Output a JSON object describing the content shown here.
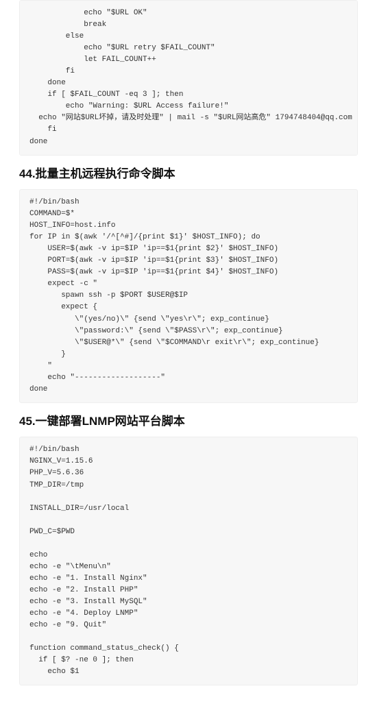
{
  "block1": {
    "code": "            echo \"$URL OK\"\n            break\n        else\n            echo \"$URL retry $FAIL_COUNT\"\n            let FAIL_COUNT++\n        fi\n    done\n    if [ $FAIL_COUNT -eq 3 ]; then\n        echo \"Warning: $URL Access failure!\"\n  echo \"网站$URL坏掉，请及时处理\" | mail -s \"$URL网站高危\" 1794748404@qq.com\n    fi\ndone"
  },
  "heading44": "44.批量主机远程执行命令脚本",
  "block2": {
    "code": "#!/bin/bash\nCOMMAND=$*\nHOST_INFO=host.info\nfor IP in $(awk '/^[^#]/{print $1}' $HOST_INFO); do\n    USER=$(awk -v ip=$IP 'ip==$1{print $2}' $HOST_INFO)\n    PORT=$(awk -v ip=$IP 'ip==$1{print $3}' $HOST_INFO)\n    PASS=$(awk -v ip=$IP 'ip==$1{print $4}' $HOST_INFO)\n    expect -c \"\n       spawn ssh -p $PORT $USER@$IP\n       expect {\n          \\\"(yes/no)\\\" {send \\\"yes\\r\\\"; exp_continue}\n          \\\"password:\\\" {send \\\"$PASS\\r\\\"; exp_continue}\n          \\\"$USER@*\\\" {send \\\"$COMMAND\\r exit\\r\\\"; exp_continue}\n       }\n    \"\n    echo \"-------------------\"\ndone"
  },
  "heading45": "45.一键部署LNMP网站平台脚本",
  "block3": {
    "code": "#!/bin/bash\nNGINX_V=1.15.6\nPHP_V=5.6.36\nTMP_DIR=/tmp\n\nINSTALL_DIR=/usr/local\n\nPWD_C=$PWD\n\necho\necho -e \"\\tMenu\\n\"\necho -e \"1. Install Nginx\"\necho -e \"2. Install PHP\"\necho -e \"3. Install MySQL\"\necho -e \"4. Deploy LNMP\"\necho -e \"9. Quit\"\n\nfunction command_status_check() {\n  if [ $? -ne 0 ]; then\n    echo $1"
  }
}
